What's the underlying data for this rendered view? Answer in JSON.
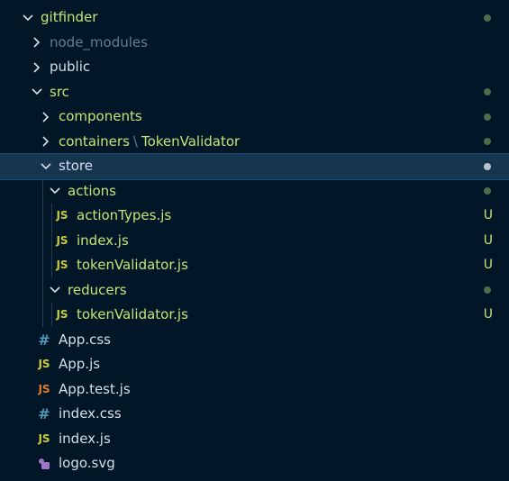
{
  "explorer": {
    "root": {
      "label": "gitfinder",
      "expanded": true,
      "modified": true
    },
    "items": [
      {
        "label": "node_modules",
        "kind": "folder",
        "expanded": false,
        "muted": true
      },
      {
        "label": "public",
        "kind": "folder",
        "expanded": false,
        "white": true
      },
      {
        "label": "src",
        "kind": "folder",
        "expanded": true,
        "modified": true
      },
      {
        "label": "components",
        "kind": "folder",
        "expanded": false,
        "modified": true
      },
      {
        "label": "containers",
        "sublabel": "TokenValidator",
        "separator": "\\",
        "kind": "folder",
        "expanded": false,
        "modified": true
      },
      {
        "label": "store",
        "kind": "folder",
        "expanded": true,
        "selected": true,
        "modified": true
      },
      {
        "label": "actions",
        "kind": "folder",
        "expanded": true,
        "modified": true
      },
      {
        "label": "actionTypes.js",
        "kind": "js",
        "status": "U"
      },
      {
        "label": "index.js",
        "kind": "js",
        "status": "U"
      },
      {
        "label": "tokenValidator.js",
        "kind": "js",
        "status": "U"
      },
      {
        "label": "reducers",
        "kind": "folder",
        "expanded": true,
        "modified": true
      },
      {
        "label": "tokenValidator.js",
        "kind": "js",
        "status": "U"
      },
      {
        "label": "App.css",
        "kind": "css"
      },
      {
        "label": "App.js",
        "kind": "js"
      },
      {
        "label": "App.test.js",
        "kind": "js-test"
      },
      {
        "label": "index.css",
        "kind": "css"
      },
      {
        "label": "index.js",
        "kind": "js"
      },
      {
        "label": "logo.svg",
        "kind": "svg"
      }
    ],
    "icons": {
      "js": "JS",
      "css": "#"
    },
    "colors": {
      "background": "#011627",
      "label": "#c5e478",
      "muted": "#5f7e97",
      "selected": "#163650",
      "dot": "#4b6e48",
      "js": "#cbcb41",
      "test": "#e37933",
      "css": "#519aba",
      "svg": "#a074c4"
    }
  }
}
